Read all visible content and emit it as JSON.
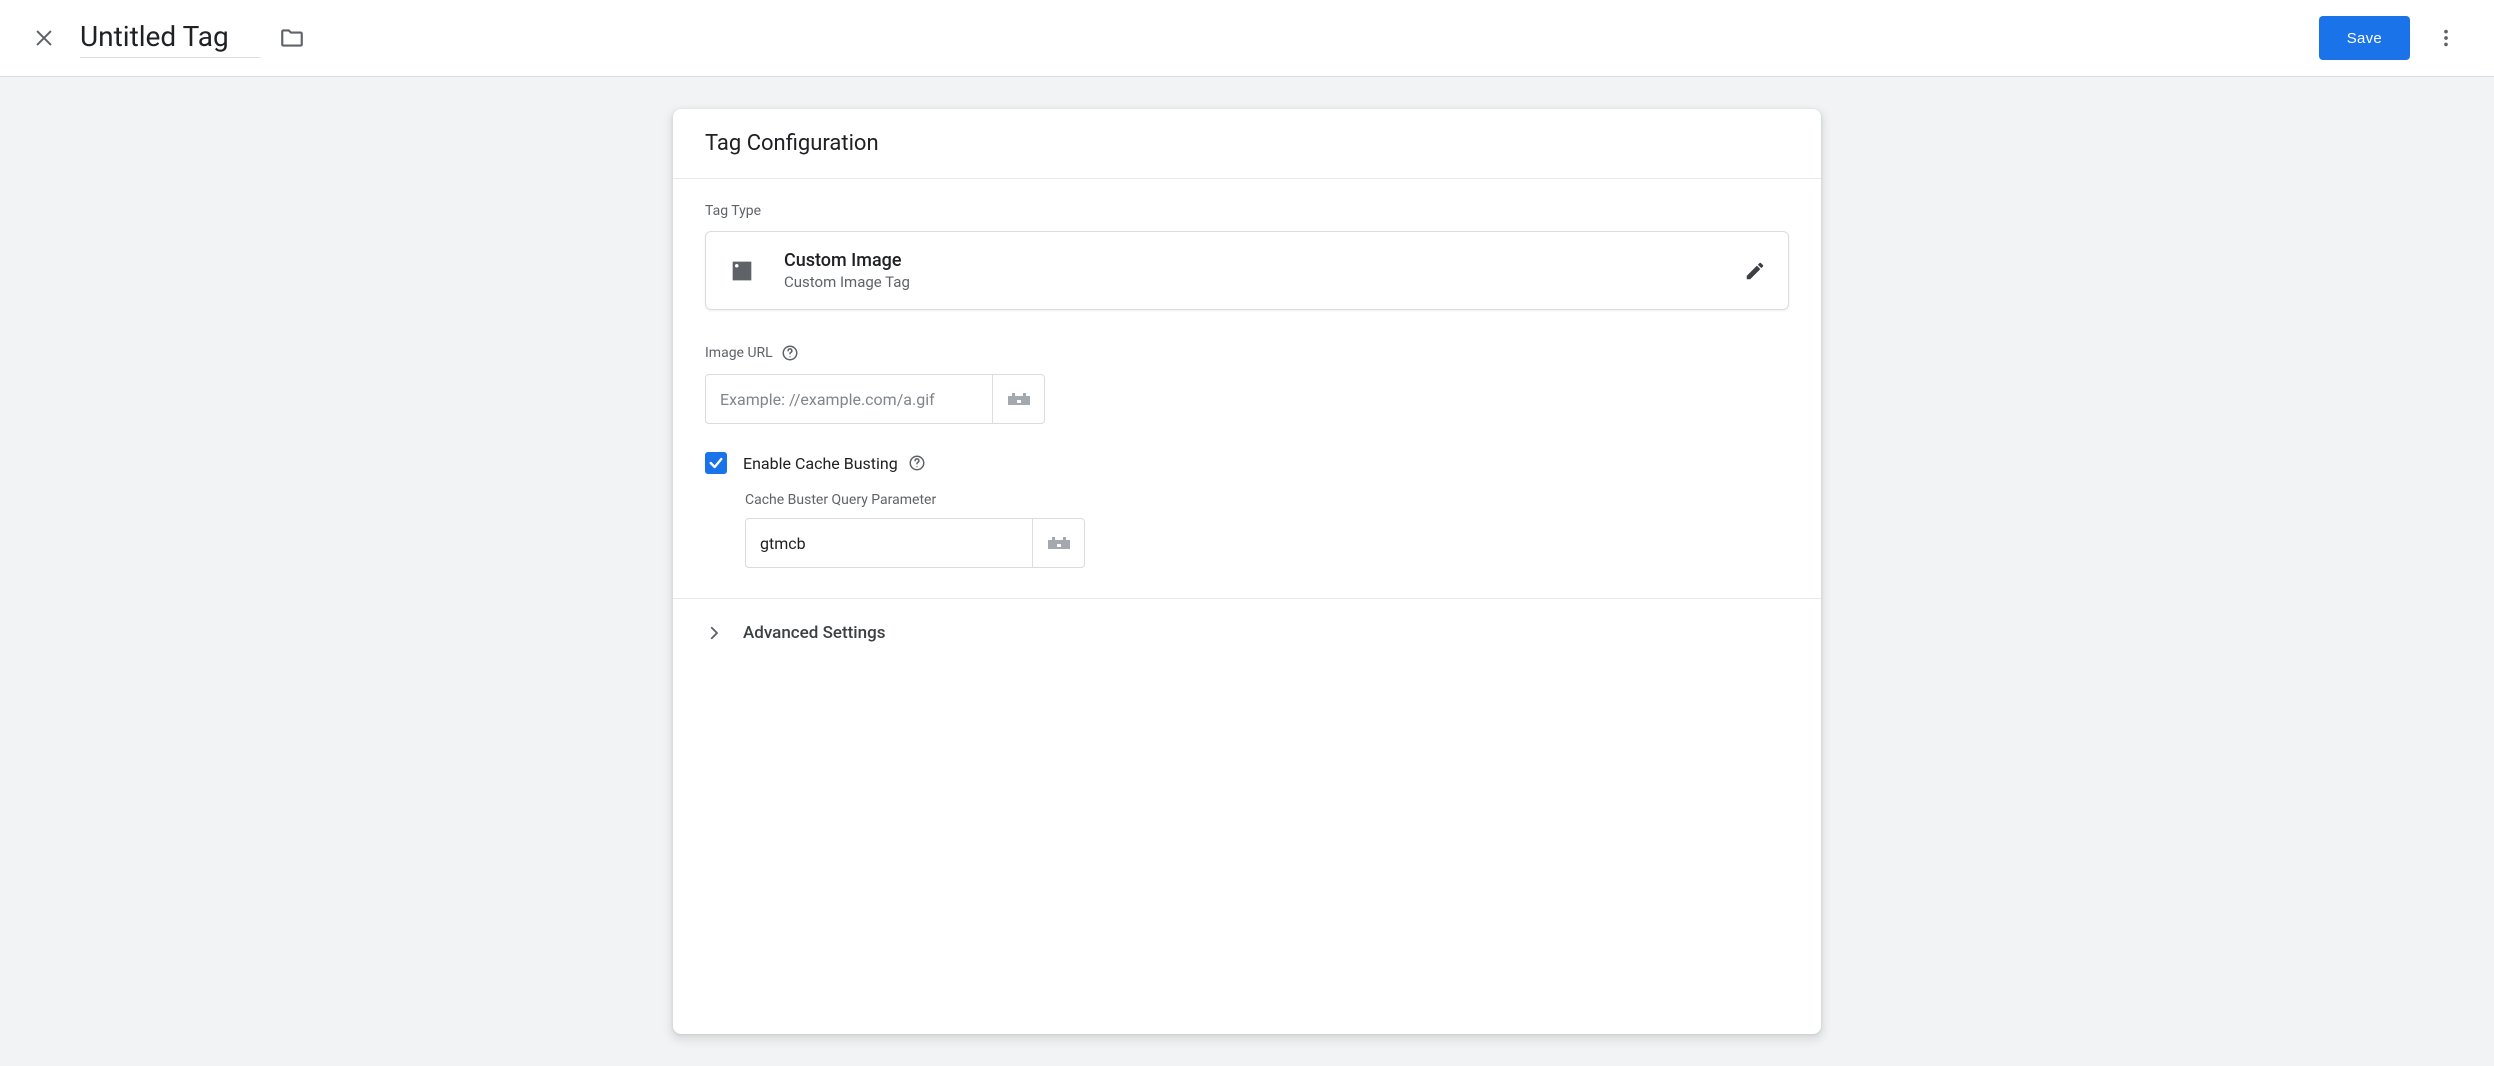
{
  "header": {
    "title": "Untitled Tag",
    "save_label": "Save"
  },
  "card": {
    "title": "Tag Configuration",
    "tag_type_label": "Tag Type",
    "selected_type": {
      "title": "Custom Image",
      "subtitle": "Custom Image Tag"
    },
    "image_url": {
      "label": "Image URL",
      "placeholder": "Example: //example.com/a.gif",
      "value": ""
    },
    "cache_busting": {
      "checked": true,
      "label": "Enable Cache Busting",
      "param_label": "Cache Buster Query Parameter",
      "param_value": "gtmcb"
    },
    "advanced_label": "Advanced Settings"
  }
}
